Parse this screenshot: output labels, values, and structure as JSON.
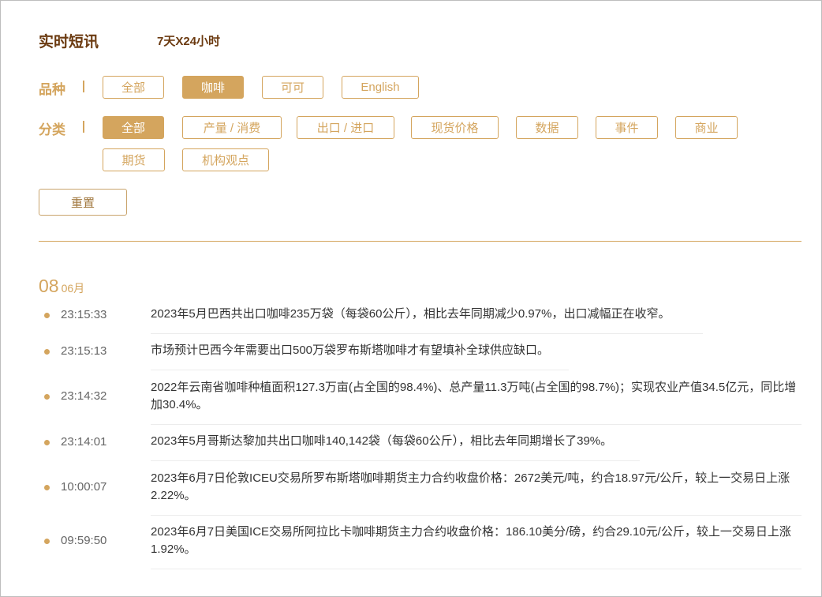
{
  "header": {
    "title": "实时短讯",
    "subtitle": "7天X24小时"
  },
  "filters": {
    "variety": {
      "label": "品种",
      "options": [
        "全部",
        "咖啡",
        "可可",
        "English"
      ],
      "selected": "咖啡"
    },
    "category": {
      "label": "分类",
      "options": [
        "全部",
        "产量 / 消费",
        "出口 / 进口",
        "现货价格",
        "数据",
        "事件",
        "商业",
        "期货",
        "机构观点"
      ],
      "selected": "全部"
    },
    "reset_label": "重置"
  },
  "date": {
    "day": "08",
    "month": "06月"
  },
  "news": [
    {
      "time": "23:15:33",
      "text": "2023年5月巴西共出口咖啡235万袋（每袋60公斤），相比去年同期减少0.97%，出口减幅正在收窄。"
    },
    {
      "time": "23:15:13",
      "text": "市场预计巴西今年需要出口500万袋罗布斯塔咖啡才有望填补全球供应缺口。"
    },
    {
      "time": "23:14:32",
      "text": "2022年云南省咖啡种植面积127.3万亩(占全国的98.4%)、总产量11.3万吨(占全国的98.7%)；实现农业产值34.5亿元，同比增加30.4%。"
    },
    {
      "time": "23:14:01",
      "text": "2023年5月哥斯达黎加共出口咖啡140,142袋（每袋60公斤），相比去年同期增长了39%。"
    },
    {
      "time": "10:00:07",
      "text": "2023年6月7日伦敦ICEU交易所罗布斯塔咖啡期货主力合约收盘价格：2672美元/吨，约合18.97元/公斤，较上一交易日上涨2.22%。"
    },
    {
      "time": "09:59:50",
      "text": "2023年6月7日美国ICE交易所阿拉比卡咖啡期货主力合约收盘价格：186.10美分/磅，约合29.10元/公斤，较上一交易日上涨1.92%。"
    }
  ],
  "colors": {
    "accent": "#d4a55e",
    "title": "#6b3a10"
  }
}
